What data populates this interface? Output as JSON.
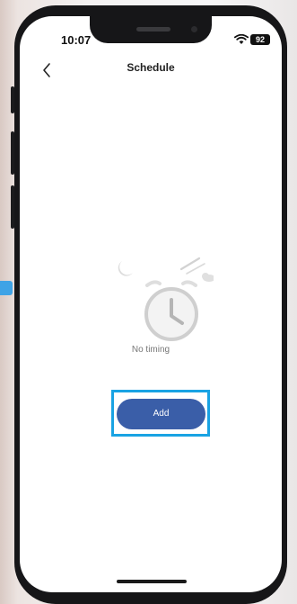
{
  "status_bar": {
    "time": "10:07",
    "battery": "92"
  },
  "nav": {
    "title": "Schedule"
  },
  "empty_state": {
    "text": "No timing"
  },
  "actions": {
    "add_label": "Add"
  },
  "colors": {
    "accent": "#3a5ea8",
    "highlight": "#19a3e3"
  },
  "icons": {
    "back": "chevron-left-icon",
    "clock": "alarm-clock-icon",
    "moon": "moon-icon",
    "cloud": "cloud-icon",
    "wifi": "wifi-icon"
  }
}
